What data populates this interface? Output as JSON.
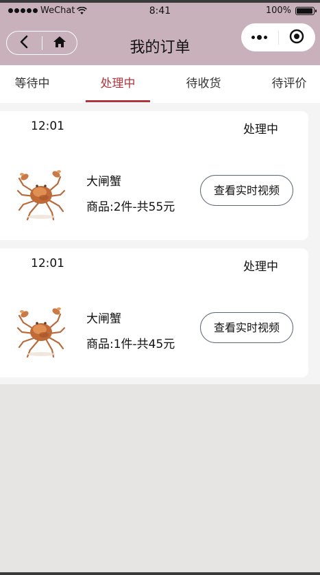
{
  "status_bar": {
    "carrier": "WeChat",
    "time": "8:41",
    "battery": "100%",
    "battery_level": 1.0
  },
  "navbar": {
    "title": "我的订单",
    "back_icon": "chevron-left-icon",
    "home_icon": "home-icon",
    "more_icon": "more-dots-icon",
    "close_icon": "target-circle-icon"
  },
  "tabs": [
    {
      "label": "等待中",
      "active": false
    },
    {
      "label": "处理中",
      "active": true
    },
    {
      "label": "待收货",
      "active": false
    },
    {
      "label": "待评价",
      "active": false
    }
  ],
  "colors": {
    "header_bg": "#c8b1bb",
    "accent": "#b1333b",
    "page_bg": "#e6e5e3"
  },
  "orders": [
    {
      "time": "12:01",
      "status": "处理中",
      "product_name": "大闸蟹",
      "summary": "商品:2件-共55元",
      "action_label": "查看实时视频",
      "image_icon": "crab-image"
    },
    {
      "time": "12:01",
      "status": "处理中",
      "product_name": "大闸蟹",
      "summary": "商品:1件-共45元",
      "action_label": "查看实时视频",
      "image_icon": "crab-image"
    }
  ]
}
